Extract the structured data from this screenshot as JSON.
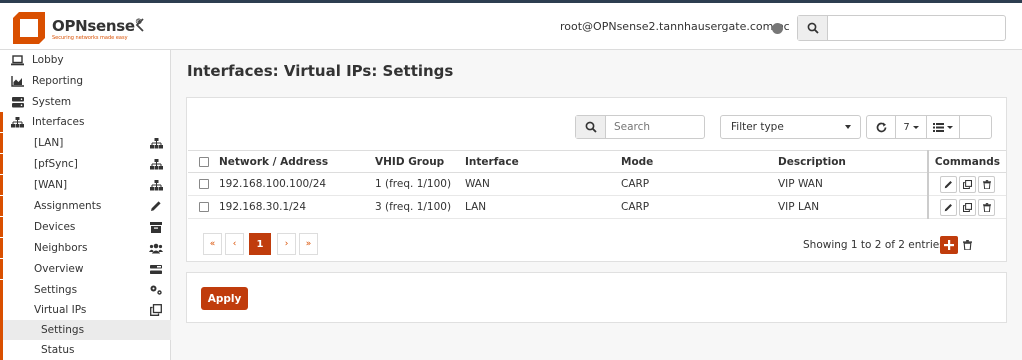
{
  "brand": {
    "name": "OPNsense",
    "reg": "®",
    "tagline": "Securing networks made easy",
    "accent": "#d94f00",
    "primary_button": "#c03c0c"
  },
  "header": {
    "collapse_icon": "chevron-left-icon",
    "user_host": "root@OPNsense2.tannhausergate.com.ec",
    "status_icon": "status-dot-icon",
    "search_placeholder": "",
    "search_value": ""
  },
  "sidebar": {
    "items": [
      {
        "label": "Lobby",
        "icon": "laptop-icon"
      },
      {
        "label": "Reporting",
        "icon": "area-chart-icon"
      },
      {
        "label": "System",
        "icon": "server-icon"
      },
      {
        "label": "Interfaces",
        "icon": "sitemap-icon"
      },
      {
        "label": "[LAN]",
        "icon": "sitemap-icon"
      },
      {
        "label": "[pfSync]",
        "icon": "sitemap-icon"
      },
      {
        "label": "[WAN]",
        "icon": "sitemap-icon"
      },
      {
        "label": "Assignments",
        "icon": "pencil-icon"
      },
      {
        "label": "Devices",
        "icon": "archive-icon"
      },
      {
        "label": "Neighbors",
        "icon": "users-icon"
      },
      {
        "label": "Overview",
        "icon": "tasks-icon"
      },
      {
        "label": "Settings",
        "icon": "cogs-icon"
      },
      {
        "label": "Virtual IPs",
        "icon": "clone-icon"
      },
      {
        "label": "Settings",
        "icon": ""
      },
      {
        "label": "Status",
        "icon": ""
      }
    ],
    "selected": "Settings"
  },
  "main": {
    "title": "Interfaces: Virtual IPs: Settings",
    "grid": {
      "search_placeholder": "Search",
      "filter_label": "Filter type",
      "row_count": "7",
      "columns": [
        "Network / Address",
        "VHID Group",
        "Interface",
        "Mode",
        "Description",
        "Commands"
      ],
      "rows": [
        {
          "address": "192.168.100.100/24",
          "vhid": "1 (freq. 1/100)",
          "interface": "WAN",
          "mode": "CARP",
          "description": "VIP WAN"
        },
        {
          "address": "192.168.30.1/24",
          "vhid": "3 (freq. 1/100)",
          "interface": "LAN",
          "mode": "CARP",
          "description": "VIP LAN"
        }
      ],
      "pager": {
        "first": "«",
        "prev": "‹",
        "current": "1",
        "next": "›",
        "last": "»"
      },
      "showing": "Showing 1 to 2 of 2 entries"
    },
    "apply_label": "Apply"
  }
}
